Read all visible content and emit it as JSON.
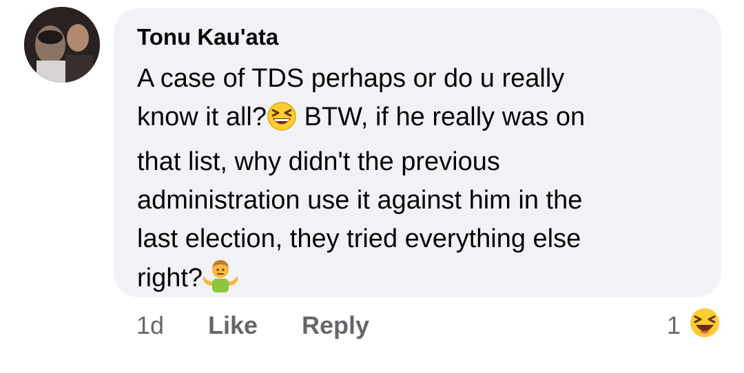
{
  "comment": {
    "author": "Tonu Kau'ata",
    "line1": "A case of TDS perhaps or do u really",
    "line2a": "know it all?",
    "line2_emoji": "grinning-squinting-face-icon",
    "line2b": " BTW, if he really was on",
    "line3": "that list, why didn't the previous",
    "line4": "administration use it against him in the",
    "line5": "last election, they tried everything else",
    "line6": "right?",
    "line6_emoji": "person-shrugging-icon"
  },
  "actions": {
    "time": "1d",
    "like": "Like",
    "reply": "Reply",
    "reaction_count": "1",
    "reaction_icon": "laughing-reaction-icon"
  },
  "colors": {
    "bubble_bg": "#f0f2f5",
    "secondary_text": "#65676b",
    "primary_text": "#050505",
    "emoji_yellow": "#ffcc33"
  }
}
